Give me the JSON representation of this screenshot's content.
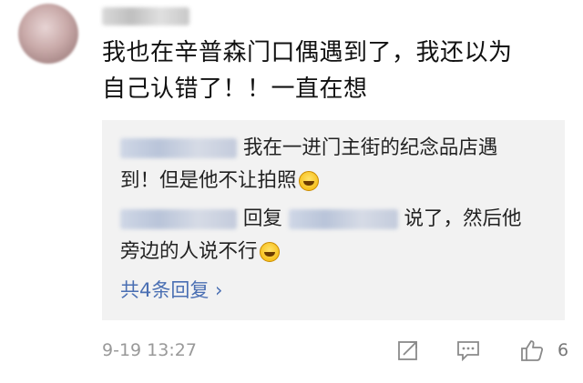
{
  "comment": {
    "line1": "我也在辛普森门口偶遇到了，我还以为",
    "line2": "自己认错了！！一直在想"
  },
  "replies": [
    {
      "text_line1": "我在一进门主街的纪念品店遇",
      "text_line2": "到！但是他不让拍照"
    },
    {
      "reply_word": "回复",
      "text_line1": "说了，然后他",
      "text_line2": "旁边的人说不行"
    }
  ],
  "more_replies_label": "共4条回复 ›",
  "footer": {
    "timestamp": "9-19 13:27",
    "like_count": "6"
  },
  "icons": [
    "share-icon",
    "comment-icon",
    "like-icon",
    "laughing-emoji-icon"
  ],
  "colors": {
    "link": "#4a6fb3",
    "reply_bg": "#f2f2f2",
    "meta_text": "#999999"
  }
}
